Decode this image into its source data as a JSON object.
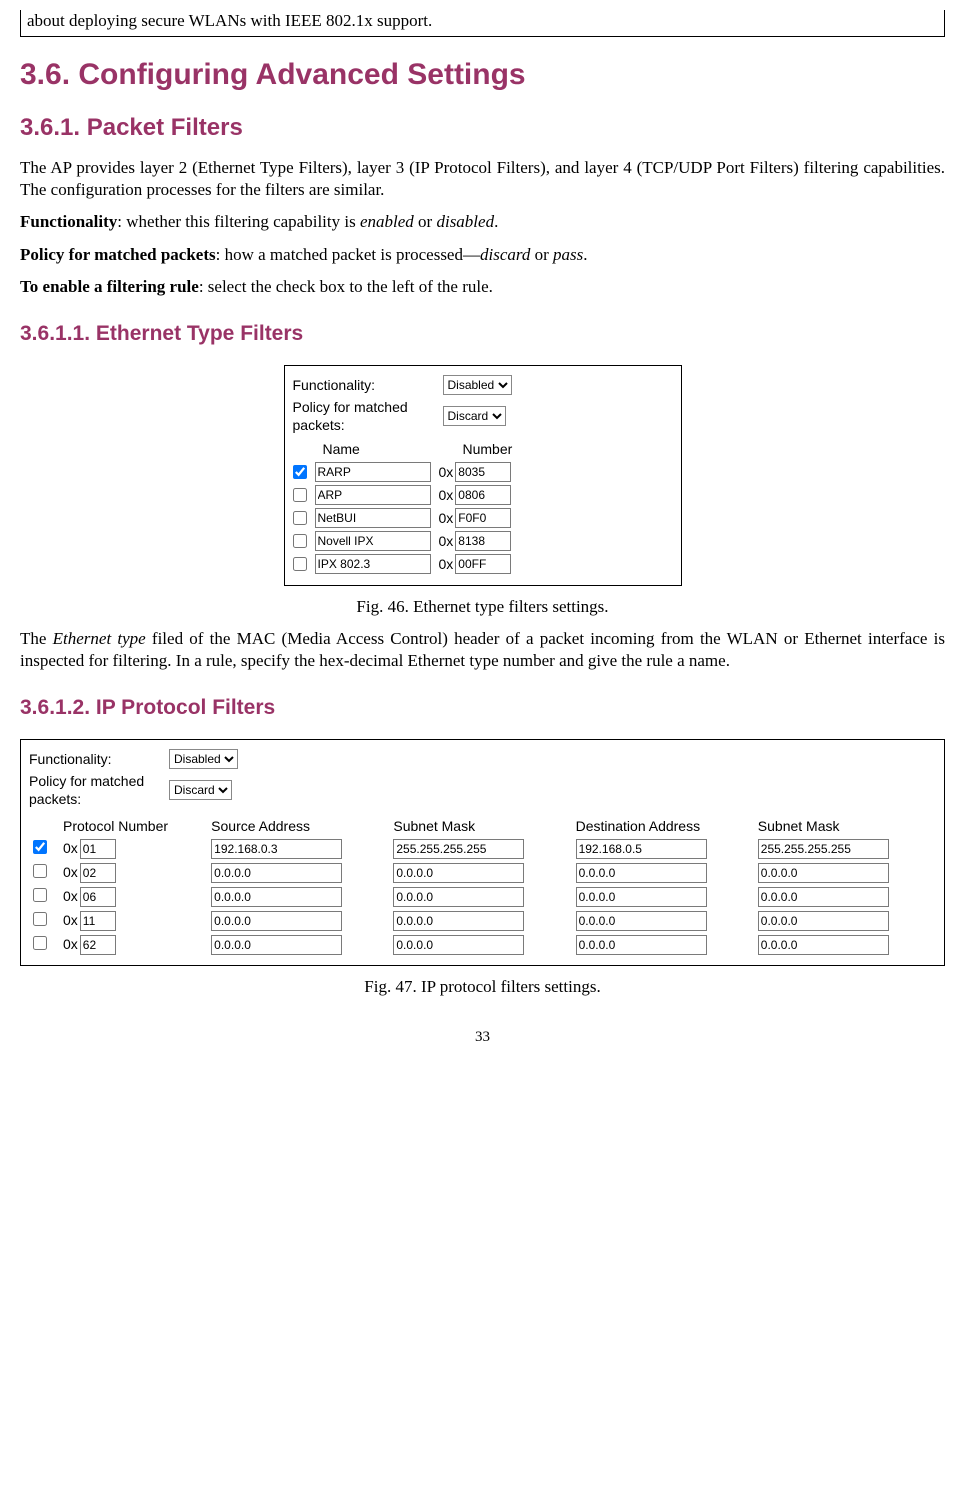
{
  "topline": "about deploying secure WLANs with IEEE 802.1x support.",
  "h1": "3.6. Configuring Advanced Settings",
  "h2_1": "3.6.1. Packet Filters",
  "para1_a": "The AP provides layer 2 (Ethernet Type Filters), layer 3 (IP Protocol Filters), and layer 4 (TCP/UDP Port Filters) filtering capabilities. The configuration processes for the filters are similar.",
  "func_b": "Functionality",
  "func_t": ": whether this filtering capability is ",
  "func_i1": "enabled",
  "func_t2": " or ",
  "func_i2": "disabled",
  "func_t3": ".",
  "pol_b": "Policy for matched packets",
  "pol_t": ": how a matched packet is processed—",
  "pol_i1": "discard",
  "pol_t2": " or ",
  "pol_i2": "pass",
  "pol_t3": ".",
  "ena_b": "To enable a filtering rule",
  "ena_t": ": select the check box to the left of the rule.",
  "h3_1": "3.6.1.1. Ethernet Type Filters",
  "panel1": {
    "func_lbl": "Functionality:",
    "func_val": "Disabled",
    "pol_lbl": "Policy for matched packets:",
    "pol_val": "Discard",
    "col_name": "Name",
    "col_num": "Number",
    "ox": "0x",
    "rows": [
      {
        "chk": true,
        "name": "RARP",
        "num": "8035"
      },
      {
        "chk": false,
        "name": "ARP",
        "num": "0806"
      },
      {
        "chk": false,
        "name": "NetBUI",
        "num": "F0F0"
      },
      {
        "chk": false,
        "name": "Novell IPX",
        "num": "8138"
      },
      {
        "chk": false,
        "name": "IPX 802.3",
        "num": "00FF"
      }
    ]
  },
  "fig46": "Fig. 46. Ethernet type filters settings.",
  "para_eth_a": "The ",
  "para_eth_i": "Ethernet type",
  "para_eth_b": " filed of the MAC (Media Access Control) header of a packet incoming from the WLAN or Ethernet interface is inspected for filtering. In a rule, specify the hex-decimal Ethernet type number and give the rule a name.",
  "h3_2": "3.6.1.2. IP Protocol Filters",
  "panel2": {
    "func_lbl": "Functionality:",
    "func_val": "Disabled",
    "pol_lbl": "Policy for matched packets:",
    "pol_val": "Discard",
    "cols": [
      "Protocol Number",
      "Source Address",
      "Subnet Mask",
      "Destination Address",
      "Subnet Mask"
    ],
    "ox": "0x",
    "rows": [
      {
        "chk": true,
        "pn": "01",
        "sa": "192.168.0.3",
        "sm": "255.255.255.255",
        "da": "192.168.0.5",
        "dm": "255.255.255.255"
      },
      {
        "chk": false,
        "pn": "02",
        "sa": "0.0.0.0",
        "sm": "0.0.0.0",
        "da": "0.0.0.0",
        "dm": "0.0.0.0"
      },
      {
        "chk": false,
        "pn": "06",
        "sa": "0.0.0.0",
        "sm": "0.0.0.0",
        "da": "0.0.0.0",
        "dm": "0.0.0.0"
      },
      {
        "chk": false,
        "pn": "11",
        "sa": "0.0.0.0",
        "sm": "0.0.0.0",
        "da": "0.0.0.0",
        "dm": "0.0.0.0"
      },
      {
        "chk": false,
        "pn": "62",
        "sa": "0.0.0.0",
        "sm": "0.0.0.0",
        "da": "0.0.0.0",
        "dm": "0.0.0.0"
      }
    ]
  },
  "fig47": "Fig. 47. IP protocol filters settings.",
  "pagenum": "33"
}
